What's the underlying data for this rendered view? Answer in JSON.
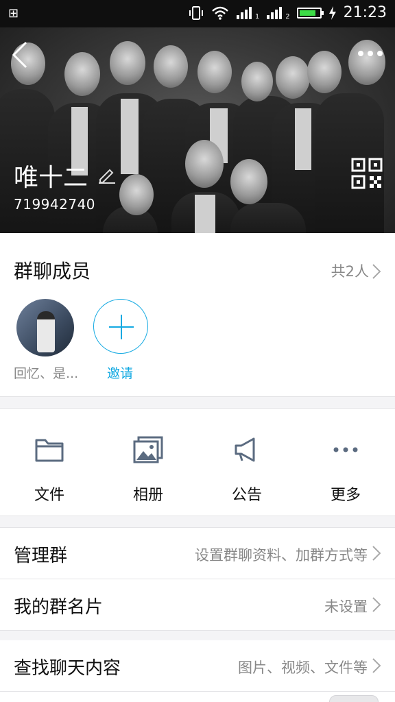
{
  "statusbar": {
    "left_glyph": "⊞",
    "time": "21:23",
    "signal_1_label": "1",
    "signal_2_label": "2",
    "battery_percent": 85
  },
  "header": {
    "group_name": "唯十二",
    "group_id": "719942740"
  },
  "members": {
    "title": "群聊成员",
    "count": "共2人",
    "member_name": "回忆、是...",
    "invite_label": "邀请"
  },
  "actions": [
    {
      "label": "文件",
      "icon": "folder-icon"
    },
    {
      "label": "相册",
      "icon": "photo-album-icon"
    },
    {
      "label": "公告",
      "icon": "megaphone-icon"
    },
    {
      "label": "更多",
      "icon": "more-dots-icon"
    }
  ],
  "rows": {
    "manage": {
      "label": "管理群",
      "value": "设置群聊资料、加群方式等"
    },
    "card": {
      "label": "我的群名片",
      "value": "未设置"
    },
    "search": {
      "label": "查找聊天内容",
      "value": "图片、视频、文件等"
    }
  },
  "colors": {
    "accent": "#12a9e2",
    "icon_gray": "#5b6b80",
    "secondary_text": "#888888"
  }
}
